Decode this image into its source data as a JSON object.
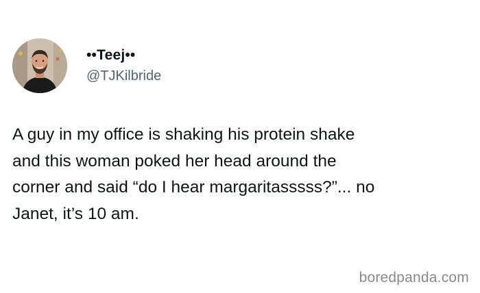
{
  "tweet": {
    "author": {
      "display_name": "••Teej••",
      "handle": "@TJKilbride",
      "avatar_icon": "profile-photo"
    },
    "text": "A guy in my office is shaking his protein shake\nand this woman poked her head around the\ncorner and said “do I hear margaritasssss?”... no\nJanet, it’s 10 am."
  },
  "watermark": "boredpanda.com",
  "colors": {
    "text": "#0f1419",
    "handle": "#536471",
    "watermark": "#8a8a8a",
    "background": "#ffffff"
  }
}
